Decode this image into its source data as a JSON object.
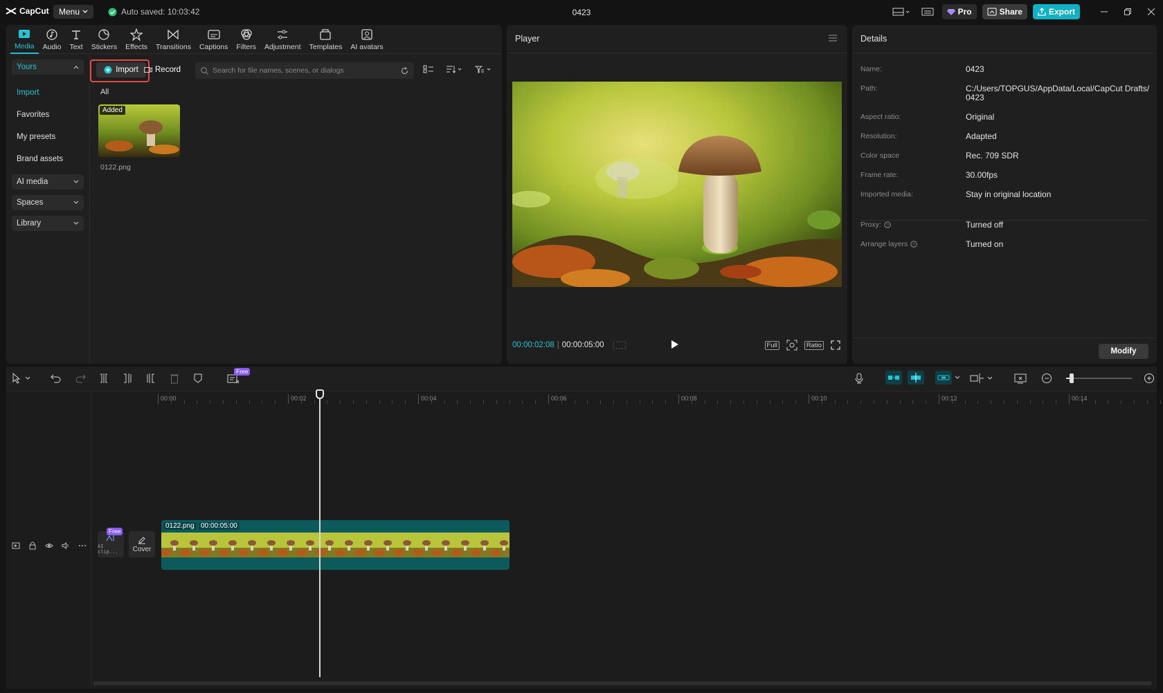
{
  "app": {
    "logo_text": "CapCut",
    "menu_label": "Menu",
    "autosave_text": "Auto saved: 10:03:42",
    "project_title": "0423",
    "pro_label": "Pro",
    "share_label": "Share",
    "export_label": "Export"
  },
  "media_tabs": [
    {
      "label": "Media",
      "icon": "media-icon",
      "active": true
    },
    {
      "label": "Audio",
      "icon": "audio-icon"
    },
    {
      "label": "Text",
      "icon": "text-icon"
    },
    {
      "label": "Stickers",
      "icon": "stickers-icon"
    },
    {
      "label": "Effects",
      "icon": "effects-icon"
    },
    {
      "label": "Transitions",
      "icon": "transitions-icon"
    },
    {
      "label": "Captions",
      "icon": "captions-icon"
    },
    {
      "label": "Filters",
      "icon": "filters-icon"
    },
    {
      "label": "Adjustment",
      "icon": "adjustment-icon"
    },
    {
      "label": "Templates",
      "icon": "templates-icon"
    },
    {
      "label": "AI avatars",
      "icon": "ai-avatars-icon"
    }
  ],
  "side_nav": {
    "yours": "Yours",
    "items": [
      "Import",
      "Favorites",
      "My presets",
      "Brand assets"
    ],
    "ai_media": "AI media",
    "spaces": "Spaces",
    "library": "Library"
  },
  "media": {
    "import_label": "Import",
    "record_label": "Record",
    "search_placeholder": "Search for file names, scenes, or dialogs",
    "filter_all": "All",
    "item": {
      "badge": "Added",
      "name": "0122.png"
    }
  },
  "player": {
    "title": "Player",
    "current_time": "00:00:02:08",
    "total_time": "00:00:05:00",
    "full_label": "Full",
    "ratio_label": "Ratio"
  },
  "details": {
    "title": "Details",
    "rows": [
      {
        "key": "Name:",
        "value": "0423"
      },
      {
        "key": "Path:",
        "value": "C:/Users/TOPGUS/AppData/Local/CapCut Drafts/​0423"
      },
      {
        "key": "Aspect ratio:",
        "value": "Original"
      },
      {
        "key": "Resolution:",
        "value": "Adapted"
      },
      {
        "key": "Color space",
        "value": "Rec. 709 SDR"
      },
      {
        "key": "Frame rate:",
        "value": "30.00fps"
      },
      {
        "key": "Imported media:",
        "value": "Stay in original location"
      }
    ],
    "extra_rows": [
      {
        "key": "Proxy:",
        "value": "Turned off"
      },
      {
        "key": "Arrange layers",
        "value": "Turned on"
      }
    ],
    "modify_label": "Modify"
  },
  "timeline": {
    "free_tag": "Free",
    "ruler": [
      "00:00",
      "00:02",
      "00:04",
      "00:06",
      "00:08",
      "00:10",
      "00:12",
      "00:14"
    ],
    "clip_name": "0122.png",
    "clip_duration": "00:00:05:00",
    "ai_clip_label": "AI clip...",
    "cover_label": "Cover",
    "zoom_level": 0.06
  },
  "colors": {
    "accent": "#22c3d3",
    "export": "#10b1c2",
    "highlight": "#e74848",
    "free": "#8a5cf6",
    "clip": "#0d5a5c"
  }
}
